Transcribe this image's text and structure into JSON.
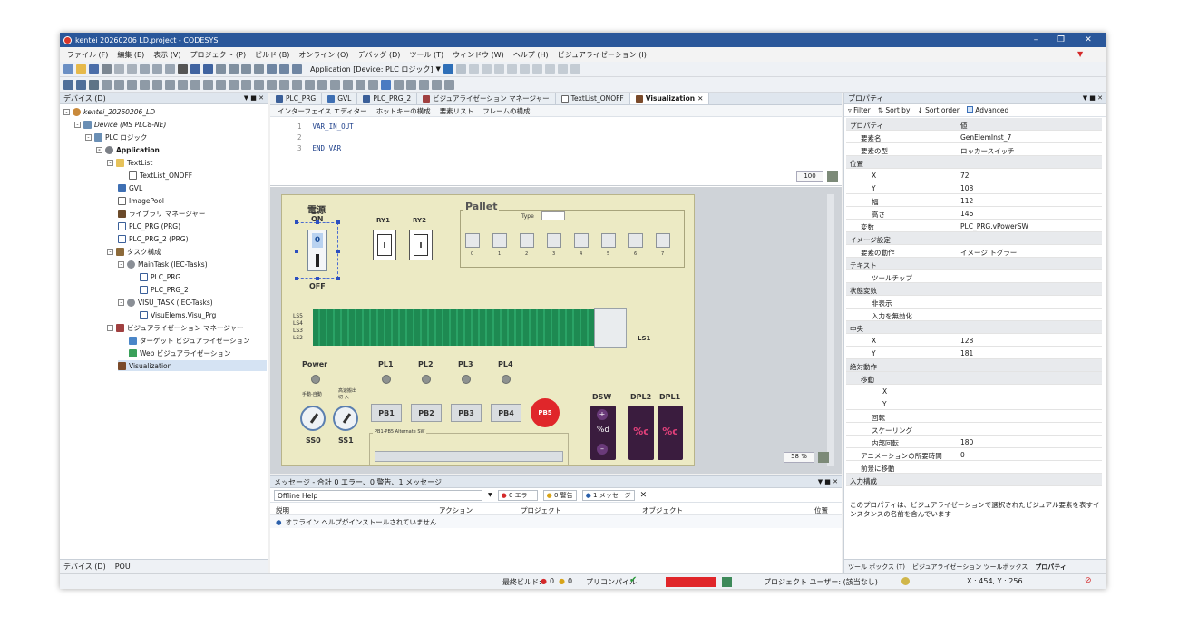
{
  "window": {
    "title": "kentei 20260206 LD.project - CODESYS"
  },
  "menu": [
    "ファイル (F)",
    "編集 (E)",
    "表示 (V)",
    "プロジェクト (P)",
    "ビルド (B)",
    "オンライン (O)",
    "デバッグ (D)",
    "ツール (T)",
    "ウィンドウ (W)",
    "ヘルプ (H)",
    "ビジュアライゼーション (I)"
  ],
  "toolbar": {
    "app_label": "Application [Device: PLC ロジック]"
  },
  "devices": {
    "title": "デバイス (D)",
    "root": "kentei_20260206_LD",
    "items": [
      "Device (MS PLC8-NE)",
      "PLC ロジック",
      "Application",
      "TextList",
      "TextList_ONOFF",
      "GVL",
      "ImagePool",
      "ライブラリ マネージャー",
      "PLC_PRG (PRG)",
      "PLC_PRG_2 (PRG)",
      "タスク構成",
      "MainTask (IEC-Tasks)",
      "PLC_PRG",
      "PLC_PRG_2",
      "VISU_TASK (IEC-Tasks)",
      "VisuElems.Visu_Prg",
      "ビジュアライゼーション マネージャー",
      "ターゲット ビジュアライゼーション",
      "Web ビジュアライゼーション",
      "Visualization"
    ],
    "bottom_tabs": [
      "デバイス (D)",
      "POU"
    ]
  },
  "editor": {
    "tabs": [
      "PLC_PRG",
      "GVL",
      "PLC_PRG_2",
      "ビジュアライゼーション マネージャー",
      "TextList_ONOFF",
      "Visualization"
    ],
    "subtabs": [
      "インターフェイス エディター",
      "ホットキーの構成",
      "要素リスト",
      "フレームの構成"
    ],
    "code_lines": [
      {
        "n": "1",
        "t": "VAR_IN_OUT"
      },
      {
        "n": "2",
        "t": ""
      },
      {
        "n": "3",
        "t": "END_VAR"
      }
    ],
    "zoom_top": "100",
    "zoom_bottom": "58 %"
  },
  "panel": {
    "power_title": "電源",
    "on": "ON",
    "off": "OFF",
    "switch_value": "0",
    "ry1": "RY1",
    "ry2": "RY2",
    "relay_value": "I",
    "pallet": "Pallet",
    "type": "Type",
    "pallet_nums": [
      "0",
      "1",
      "2",
      "3",
      "4",
      "5",
      "6",
      "7"
    ],
    "ls_labels": [
      "LS5",
      "LS4",
      "LS3",
      "LS2"
    ],
    "ls1": "LS1",
    "lamps": [
      "Power",
      "PL1",
      "PL2",
      "PL3",
      "PL4"
    ],
    "knob_captions": [
      "手動-自動",
      "高速搬出 切-入"
    ],
    "ss": [
      "SS0",
      "SS1"
    ],
    "pbs": [
      "PB1",
      "PB2",
      "PB3",
      "PB4"
    ],
    "pb5": "PB5",
    "alt_sw": "PB1-PB5 Alternate SW",
    "dsw": "DSW",
    "dpl2": "DPL2",
    "dpl1": "DPL1",
    "dsw_value": "%d",
    "dpl_value": "%c"
  },
  "messages": {
    "title": "メッセージ - 合計 0 エラー、0 警告、1 メッセージ",
    "filter": "Offline Help",
    "counts": [
      "0 エラー",
      "0 警告",
      "1 メッセージ"
    ],
    "cols": [
      "説明",
      "アクション",
      "プロジェクト",
      "オブジェクト",
      "位置"
    ],
    "row": "オフライン ヘルプがインストールされていません"
  },
  "props": {
    "title": "プロパティ",
    "toolbar": [
      "Filter",
      "Sort by",
      "Sort order",
      "Advanced"
    ],
    "head": [
      "プロパティ",
      "値"
    ],
    "rows": [
      {
        "k": "要素名",
        "v": "GenElemInst_7",
        "s": 0,
        "i": 1
      },
      {
        "k": "要素の型",
        "v": "ロッカースイッチ",
        "s": 0,
        "i": 1
      },
      {
        "k": "位置",
        "v": "",
        "s": 1,
        "i": 0
      },
      {
        "k": "X",
        "v": "72",
        "s": 0,
        "i": 2
      },
      {
        "k": "Y",
        "v": "108",
        "s": 0,
        "i": 2
      },
      {
        "k": "幅",
        "v": "112",
        "s": 0,
        "i": 2
      },
      {
        "k": "高さ",
        "v": "146",
        "s": 0,
        "i": 2
      },
      {
        "k": "変数",
        "v": "PLC_PRG.vPowerSW",
        "s": 0,
        "i": 1
      },
      {
        "k": "イメージ設定",
        "v": "",
        "s": 1,
        "i": 0
      },
      {
        "k": "要素の動作",
        "v": "イメージ トグラー",
        "s": 0,
        "i": 1
      },
      {
        "k": "テキスト",
        "v": "",
        "s": 1,
        "i": 0
      },
      {
        "k": "ツールチップ",
        "v": "",
        "s": 0,
        "i": 2
      },
      {
        "k": "状態変数",
        "v": "",
        "s": 1,
        "i": 0
      },
      {
        "k": "非表示",
        "v": "",
        "s": 0,
        "i": 2
      },
      {
        "k": "入力を無効化",
        "v": "",
        "s": 0,
        "i": 2
      },
      {
        "k": "中央",
        "v": "",
        "s": 1,
        "i": 0
      },
      {
        "k": "X",
        "v": "128",
        "s": 0,
        "i": 2
      },
      {
        "k": "Y",
        "v": "181",
        "s": 0,
        "i": 2
      },
      {
        "k": "絶対動作",
        "v": "",
        "s": 1,
        "i": 0
      },
      {
        "k": "移動",
        "v": "",
        "s": 1,
        "i": 1
      },
      {
        "k": "X",
        "v": "",
        "s": 0,
        "i": 3
      },
      {
        "k": "Y",
        "v": "",
        "s": 0,
        "i": 3
      },
      {
        "k": "回転",
        "v": "",
        "s": 0,
        "i": 2
      },
      {
        "k": "スケーリング",
        "v": "",
        "s": 0,
        "i": 2
      },
      {
        "k": "内部回転",
        "v": "180",
        "s": 0,
        "i": 2
      },
      {
        "k": "アニメーションの所要時間",
        "v": "0",
        "s": 0,
        "i": 1
      },
      {
        "k": "前景に移動",
        "v": "",
        "s": 0,
        "i": 1
      },
      {
        "k": "入力構成",
        "v": "",
        "s": 1,
        "i": 0
      }
    ],
    "desc": "このプロパティは、ビジュアライゼーションで選択されたビジュアル要素を表すインスタンスの名前を含んでいます",
    "bottom_tabs": [
      "ツール ボックス (T)",
      "ビジュアライゼーション ツールボックス",
      "プロパティ"
    ]
  },
  "status": {
    "last_build": "最終ビルド:",
    "err": "0",
    "warn": "0",
    "precompile": "プリコンパイル",
    "project_user": "プロジェクト ユーザー: (該当なし)",
    "coords": "X : 454, Y : 256"
  }
}
